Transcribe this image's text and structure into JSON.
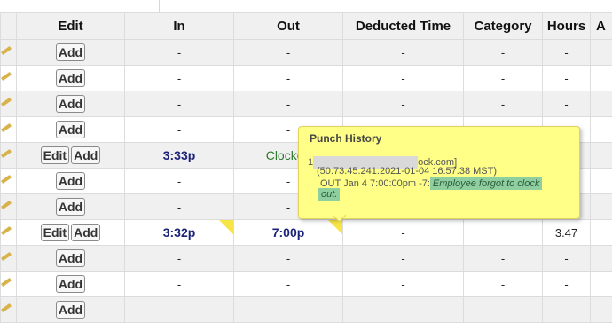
{
  "columns": {
    "edit": "Edit",
    "in": "In",
    "out": "Out",
    "deducted": "Deducted Time",
    "category": "Category",
    "hours": "Hours",
    "next": "A"
  },
  "buttons": {
    "add": "Add",
    "edit": "Edit"
  },
  "rows": [
    {
      "edit": false,
      "in": "-",
      "out": "-",
      "deducted": "-",
      "category": "-",
      "hours": "-"
    },
    {
      "edit": false,
      "in": "-",
      "out": "-",
      "deducted": "-",
      "category": "-",
      "hours": "-"
    },
    {
      "edit": false,
      "in": "-",
      "out": "-",
      "deducted": "-",
      "category": "-",
      "hours": "-"
    },
    {
      "edit": false,
      "in": "-",
      "out": "-",
      "deducted": "",
      "category": "",
      "hours": ""
    },
    {
      "edit": true,
      "in": "3:33p",
      "out": "Clocked",
      "deducted": "",
      "category": "",
      "hours": ""
    },
    {
      "edit": false,
      "in": "-",
      "out": "-",
      "deducted": "",
      "category": "",
      "hours": ""
    },
    {
      "edit": false,
      "in": "-",
      "out": "-",
      "deducted": "",
      "category": "",
      "hours": ""
    },
    {
      "edit": true,
      "in": "3:32p",
      "out": "7:00p",
      "deducted": "-",
      "category": "",
      "hours": "3.47"
    },
    {
      "edit": false,
      "in": "-",
      "out": "-",
      "deducted": "-",
      "category": "-",
      "hours": "-"
    },
    {
      "edit": false,
      "in": "-",
      "out": "-",
      "deducted": "-",
      "category": "-",
      "hours": "-"
    },
    {
      "edit": false,
      "in": "",
      "out": "",
      "deducted": "",
      "category": "",
      "hours": ""
    }
  ],
  "popup": {
    "title": "Punch History",
    "line1_prefix": "1",
    "line1_suffix": "ock.com]",
    "line2": "(50.73.45.241.2021-01-04 16:57:38 MST)",
    "line3_prefix": "OUT Jan 4 7:00:00pm -7:",
    "note_part1": "Employee forgot to clock",
    "note_part2": "out."
  }
}
